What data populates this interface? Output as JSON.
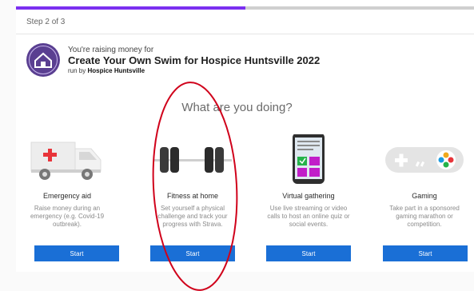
{
  "progress": {
    "step_text": "Step 2 of 3",
    "percent": 50
  },
  "fundraiser": {
    "raising_text": "You're raising money for",
    "campaign_title": "Create Your Own Swim for Hospice Huntsville 2022",
    "run_by_prefix": "run by",
    "organizer": "Hospice Huntsville",
    "logo_text": "HOSPICE HUNTSVILLE"
  },
  "question": "What are you doing?",
  "options": [
    {
      "title": "Emergency aid",
      "description": "Raise money during an emergency (e.g. Covid-19 outbreak).",
      "button": "Start",
      "icon": "ambulance-icon"
    },
    {
      "title": "Fitness at home",
      "description": "Set yourself a physical challenge and track your progress with Strava.",
      "button": "Start",
      "icon": "dumbbell-icon"
    },
    {
      "title": "Virtual gathering",
      "description": "Use live streaming or video calls to host an online quiz or social events.",
      "button": "Start",
      "icon": "phone-icon"
    },
    {
      "title": "Gaming",
      "description": "Take part in a sponsored gaming marathon or competition.",
      "button": "Start",
      "icon": "gamepad-icon"
    }
  ],
  "colors": {
    "accent": "#7b2ff0",
    "button": "#1a6fd6",
    "annotation": "#d0021b"
  }
}
